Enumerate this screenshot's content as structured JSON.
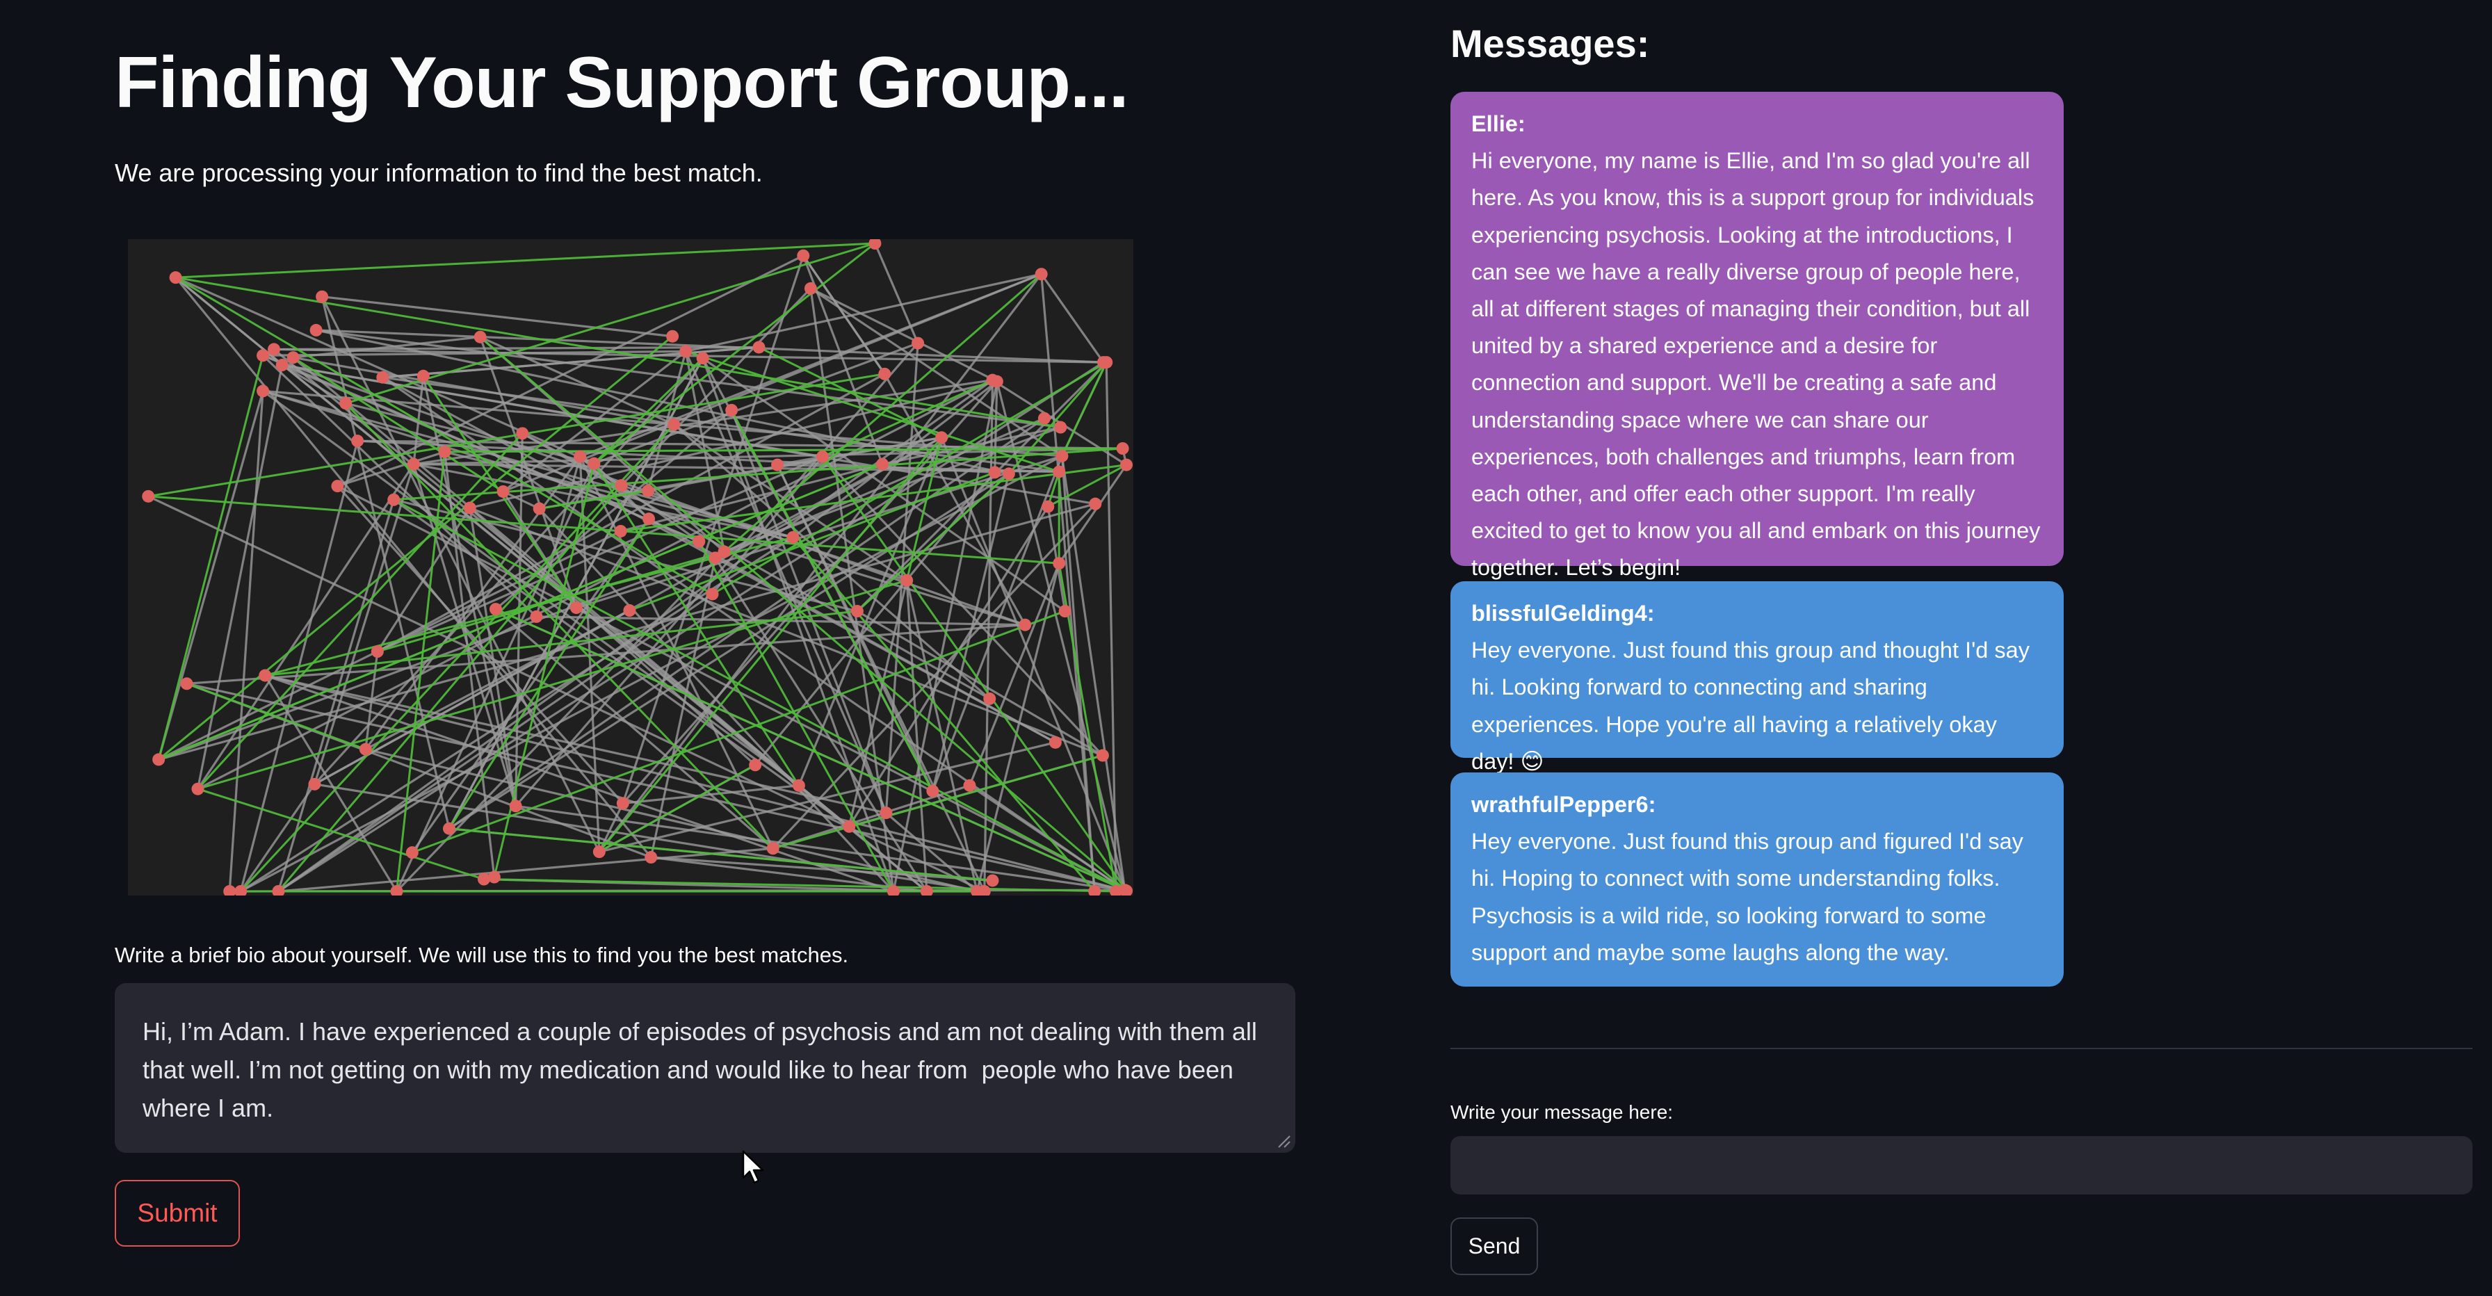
{
  "left": {
    "title": "Finding Your Support Group...",
    "subtitle": "We are processing your information to find the best match.",
    "bio_label": "Write a brief bio about yourself. We will use this to find you the best matches.",
    "bio_value": "Hi, I’m Adam. I have experienced a couple of episodes of psychosis and am not dealing with them all that well. I’m not getting on with my medication and would like to hear from  people who have been where I am.",
    "submit_label": "Submit"
  },
  "network_graph": {
    "node_color": "#e0625f",
    "edge_color": "#9a9a9a",
    "highlight_edge_color": "#4fb83a",
    "background": "#1f1f1f"
  },
  "right": {
    "messages_title": "Messages:",
    "messages": [
      {
        "author": "Ellie:",
        "text": "Hi everyone, my name is Ellie, and I'm so glad you're all here. As you know, this is a support group for individuals experiencing psychosis. Looking at the introductions, I can see we have a really diverse group of people here, all at different stages of managing their condition, but all united by a shared experience and a desire for connection and support. We'll be creating a safe and understanding space where we can share our experiences, both challenges and triumphs, learn from each other, and offer each other support. I'm really excited to get to know you all and embark on this journey together. Let’s begin!",
        "color": "#9b59b6"
      },
      {
        "author": "blissfulGelding4:",
        "text": "Hey everyone. Just found this group and thought I'd say hi. Looking forward to connecting and sharing experiences. Hope you're all having a relatively okay day! 😊",
        "color": "#4a90d9"
      },
      {
        "author": "wrathfulPepper6:",
        "text": "Hey everyone. Just found this group and figured I'd say hi. Hoping to connect with some understanding folks. Psychosis is a wild ride, so looking forward to some support and maybe some laughs along the way.",
        "color": "#4a90d9"
      }
    ],
    "input_label": "Write your message here:",
    "input_value": "",
    "send_label": "Send"
  },
  "colors": {
    "background": "#0e1117",
    "input_background": "#262730",
    "submit_accent": "#ff5a55"
  }
}
